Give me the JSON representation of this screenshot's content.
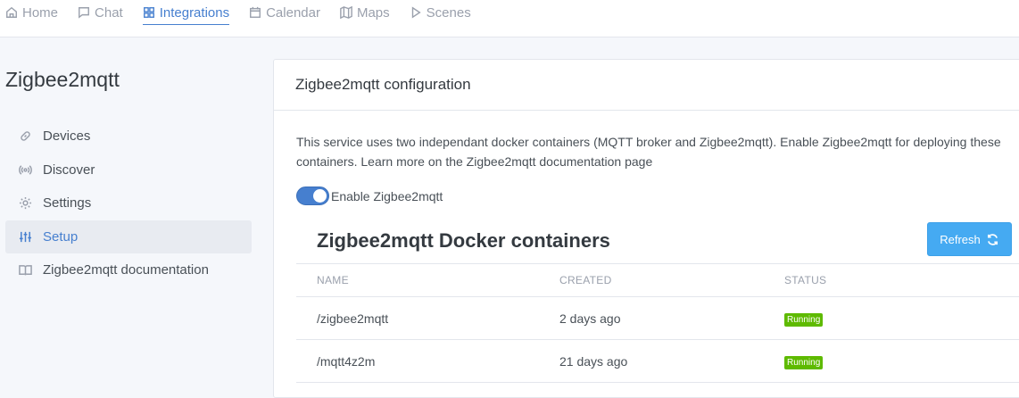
{
  "nav": {
    "items": [
      {
        "label": "Home",
        "icon": "home-icon"
      },
      {
        "label": "Chat",
        "icon": "chat-icon"
      },
      {
        "label": "Integrations",
        "icon": "grid-icon"
      },
      {
        "label": "Calendar",
        "icon": "calendar-icon"
      },
      {
        "label": "Maps",
        "icon": "map-icon"
      },
      {
        "label": "Scenes",
        "icon": "play-icon"
      }
    ],
    "active": "Integrations"
  },
  "sidebar": {
    "title": "Zigbee2mqtt",
    "items": [
      {
        "label": "Devices",
        "icon": "link-icon"
      },
      {
        "label": "Discover",
        "icon": "radio-icon"
      },
      {
        "label": "Settings",
        "icon": "gear-icon"
      },
      {
        "label": "Setup",
        "icon": "sliders-icon"
      },
      {
        "label": "Zigbee2mqtt documentation",
        "icon": "book-icon"
      }
    ],
    "active": "Setup"
  },
  "card": {
    "header": "Zigbee2mqtt configuration",
    "description": "This service uses two independant docker containers (MQTT broker and Zigbee2mqtt). Enable Zigbee2mqtt for deploying these containers. Learn more on the Zigbee2mqtt documentation page",
    "toggle_label": "Enable Zigbee2mqtt",
    "toggle_on": true,
    "containers_title": "Zigbee2mqtt Docker containers",
    "refresh_label": "Refresh",
    "table": {
      "headers": [
        "NAME",
        "CREATED",
        "STATUS"
      ],
      "rows": [
        {
          "name": "/zigbee2mqtt",
          "created": "2 days ago",
          "status": "Running"
        },
        {
          "name": "/mqtt4z2m",
          "created": "21 days ago",
          "status": "Running"
        }
      ]
    }
  },
  "colors": {
    "accent": "#467fcf",
    "refresh_button": "#45aaf2",
    "running_badge": "#5eba00"
  }
}
